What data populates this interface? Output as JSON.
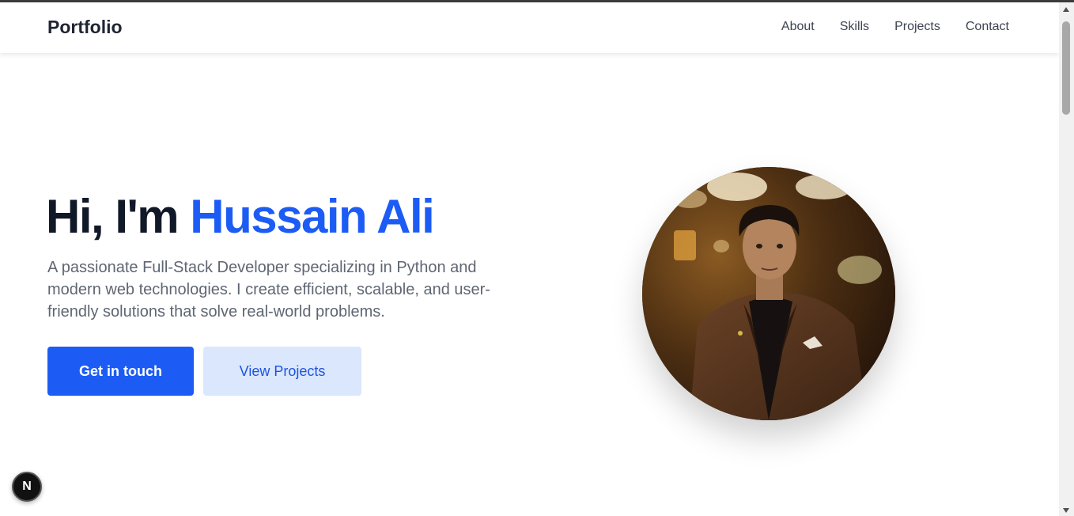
{
  "navbar": {
    "brand": "Portfolio",
    "links": [
      "About",
      "Skills",
      "Projects",
      "Contact"
    ]
  },
  "hero": {
    "greeting": "Hi, I'm ",
    "name": "Hussain Ali",
    "description": "A passionate Full-Stack Developer specializing in Python and modern web technologies. I create efficient, scalable, and user-friendly solutions that solve real-world problems.",
    "primary_button": "Get in touch",
    "secondary_button": "View Projects"
  },
  "dev_badge": {
    "label": "N"
  },
  "colors": {
    "accent": "#1c5cf5",
    "accent_light": "#dbe7fd",
    "heading": "#111827",
    "body_text": "#5f6673"
  }
}
